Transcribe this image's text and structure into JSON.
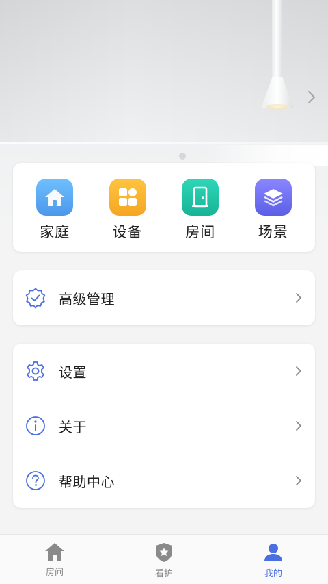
{
  "hero": {
    "next_icon": "chevron-right-icon"
  },
  "quick_actions": [
    {
      "label": "家庭",
      "icon": "home-icon",
      "color": "#5aa8f0"
    },
    {
      "label": "设备",
      "icon": "device-grid-icon",
      "color": "#f7b52c"
    },
    {
      "label": "房间",
      "icon": "door-icon",
      "color": "#1fc2a7"
    },
    {
      "label": "场景",
      "icon": "layers-icon",
      "color": "#6d72ee"
    }
  ],
  "advanced": {
    "label": "高级管理",
    "icon": "shield-check-icon"
  },
  "settings_list": [
    {
      "label": "设置",
      "icon": "gear-icon"
    },
    {
      "label": "关于",
      "icon": "info-icon"
    },
    {
      "label": "帮助中心",
      "icon": "question-icon"
    }
  ],
  "bottom_nav": {
    "items": [
      {
        "label": "房间",
        "icon": "house-icon",
        "active": false
      },
      {
        "label": "看护",
        "icon": "shield-star-icon",
        "active": false
      },
      {
        "label": "我的",
        "icon": "person-icon",
        "active": true
      }
    ]
  },
  "colors": {
    "accent": "#4a6fe0",
    "outline_icon": "#4a6fe0",
    "inactive_nav": "#888888"
  }
}
